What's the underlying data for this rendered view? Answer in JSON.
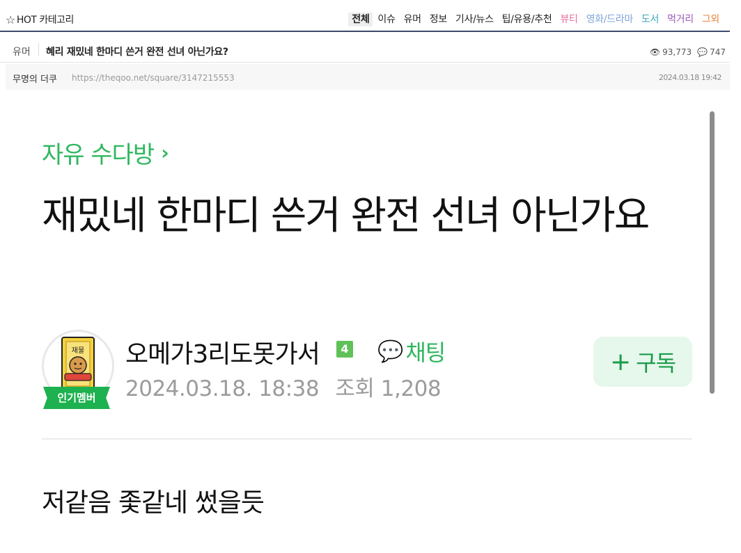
{
  "header": {
    "hot_category_label": "HOT 카테고리",
    "categories": [
      {
        "label": "전체",
        "color": "#222222",
        "active": true
      },
      {
        "label": "이슈",
        "color": "#222222"
      },
      {
        "label": "유머",
        "color": "#222222"
      },
      {
        "label": "정보",
        "color": "#222222"
      },
      {
        "label": "기사/뉴스",
        "color": "#222222"
      },
      {
        "label": "팁/유용/추천",
        "color": "#222222"
      },
      {
        "label": "뷰티",
        "color": "#e76fa0"
      },
      {
        "label": "영화/드라마",
        "color": "#7fa3d9"
      },
      {
        "label": "도서",
        "color": "#3aa6b9"
      },
      {
        "label": "먹거리",
        "color": "#9b59b6"
      },
      {
        "label": "그외",
        "color": "#e8833a"
      }
    ]
  },
  "post": {
    "category": "유머",
    "title": "혜리 재밌네 한마디 쓴거 완전 선녀 아닌가요?",
    "views": "93,773",
    "comments": "747",
    "author": "무명의 더쿠",
    "url": "https://theqoo.net/square/3147215553",
    "date": "2024.03.18 19:42"
  },
  "embed": {
    "board_name": "자유 수다방",
    "title": "재밌네 한마디 쓴거 완전 선녀 아닌가요",
    "avatar_text": "재물",
    "badge": "인기멤버",
    "nickname": "오메가3리도못가서",
    "level": "4",
    "chat_label": "채팅",
    "date": "2024.03.18. 18:38",
    "views_label": "조회 1,208",
    "subscribe_label": "구독",
    "body": "저같음 좇같네 썼을듯"
  },
  "icons": {
    "star": "star-outline-icon",
    "views": "eye-icon",
    "comments": "comment-icon",
    "chat": "chat-bubble-icon",
    "board_chevron": "chevron-right-icon",
    "plus": "plus-icon"
  },
  "colors": {
    "accent_green": "#2fb75f",
    "badge_green": "#1db14f",
    "level_green": "#5fc158",
    "subscribe_bg": "#e6f7ec",
    "header_border": "#3b4a6b"
  }
}
